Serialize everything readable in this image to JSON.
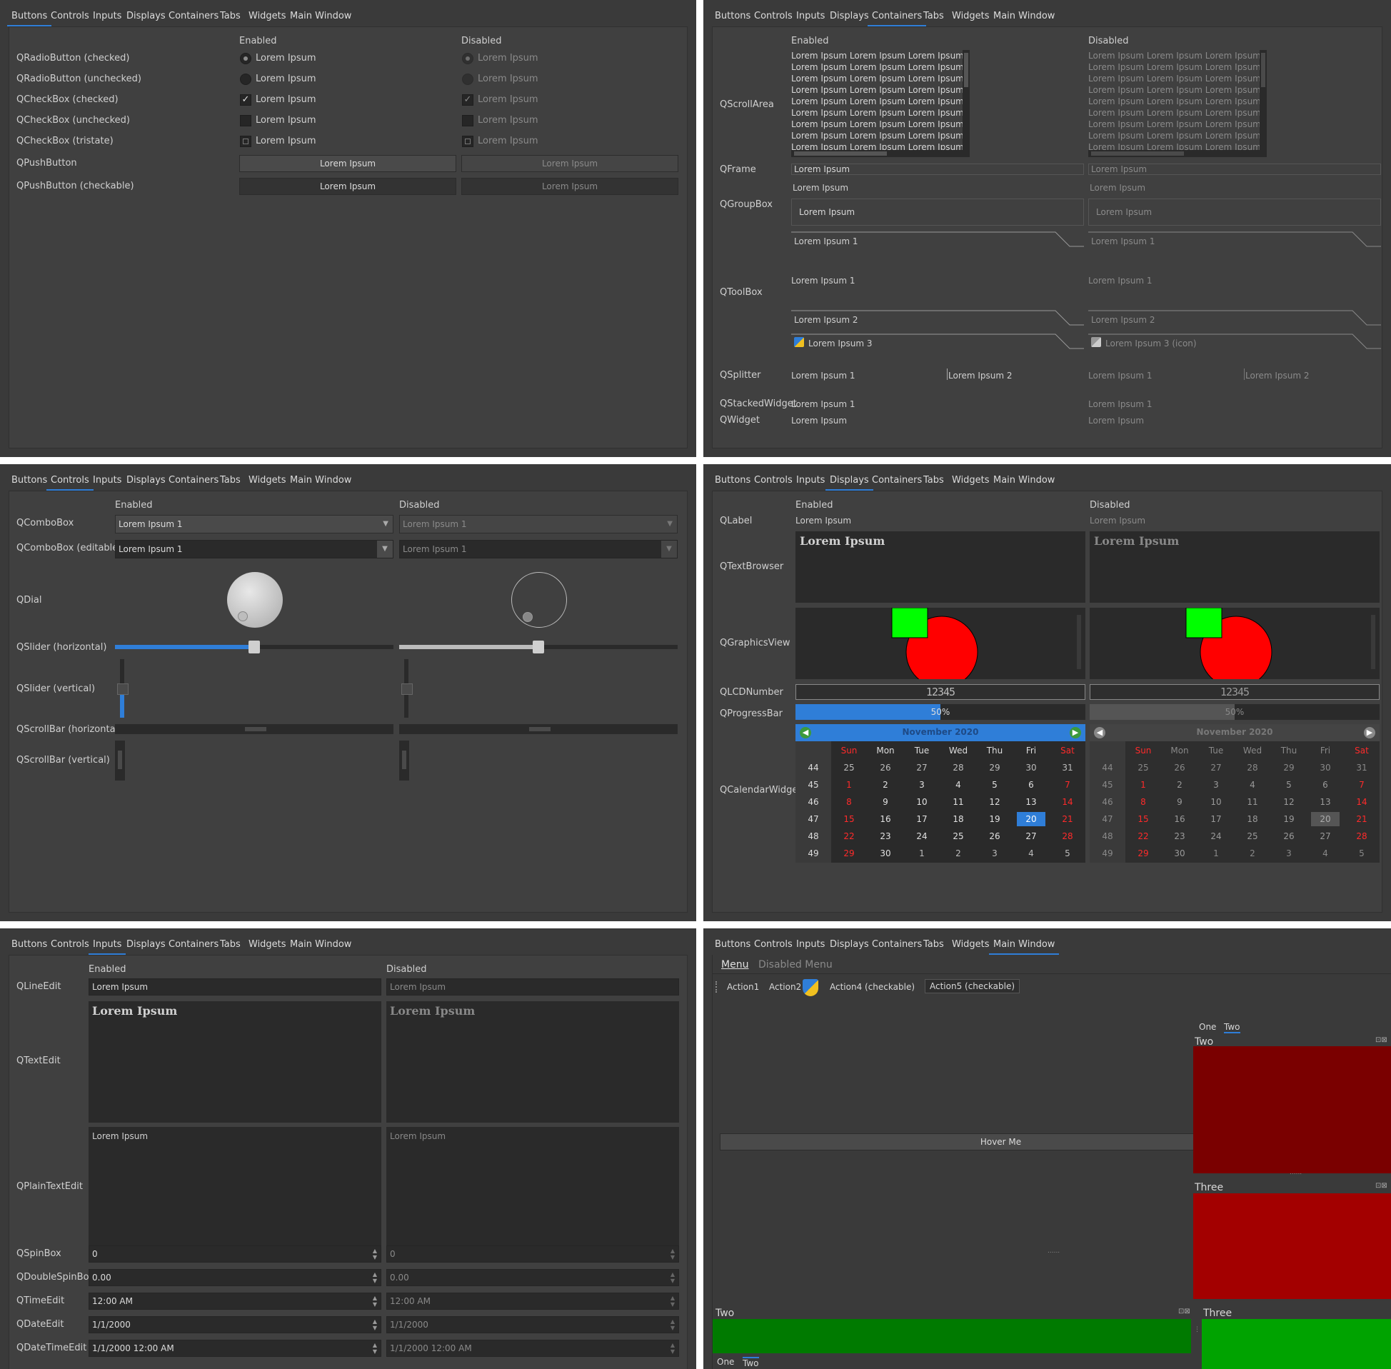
{
  "tabs": [
    "Buttons",
    "Controls",
    "Inputs",
    "Displays",
    "Containers",
    "Tabs",
    "Widgets",
    "Main Window"
  ],
  "common": {
    "enabled": "Enabled",
    "disabled": "Disabled",
    "lorem": "Lorem Ipsum",
    "lorem1": "Lorem Ipsum 1",
    "lorem2": "Lorem Ipsum 2",
    "lorem3": "Lorem Ipsum 3",
    "lorem3icon": "Lorem Ipsum 3 (icon)",
    "scroll_line": "Lorem Ipsum Lorem Ipsum Lorem Ipsum"
  },
  "buttons_panel": {
    "active_tab": "Buttons",
    "rows": [
      "QRadioButton (checked)",
      "QRadioButton (unchecked)",
      "QCheckBox (checked)",
      "QCheckBox (unchecked)",
      "QCheckBox (tristate)",
      "QPushButton",
      "QPushButton (checkable)"
    ]
  },
  "containers_panel": {
    "active_tab": "Containers",
    "rows": {
      "scroll": "QScrollArea",
      "frame": "QFrame",
      "group": "QGroupBox",
      "toolbox": "QToolBox",
      "splitter": "QSplitter",
      "stacked": "QStackedWidget",
      "widget": "QWidget"
    }
  },
  "controls_panel": {
    "active_tab": "Controls",
    "rows": {
      "combo": "QComboBox",
      "combo_edit": "QComboBox (editable)",
      "dial": "QDial",
      "slider_h": "QSlider (horizontal)",
      "slider_v": "QSlider (vertical)",
      "scroll_h": "QScrollBar (horizontal)",
      "scroll_v": "QScrollBar (vertical)"
    },
    "slider_value": 0.5
  },
  "displays_panel": {
    "active_tab": "Displays",
    "rows": {
      "label": "QLabel",
      "textbrowser": "QTextBrowser",
      "graphics": "QGraphicsView",
      "lcd": "QLCDNumber",
      "progress": "QProgressBar",
      "calendar": "QCalendarWidget"
    },
    "lcd_value": "12345",
    "progress_value": 0.5,
    "progress_text": "50%",
    "calendar": {
      "month": "November",
      "year": "2020",
      "days": [
        "Sun",
        "Mon",
        "Tue",
        "Wed",
        "Thu",
        "Fri",
        "Sat"
      ],
      "weeks": [
        "44",
        "45",
        "46",
        "47",
        "48",
        "49"
      ],
      "dates": [
        [
          "25",
          "26",
          "27",
          "28",
          "29",
          "30",
          "31"
        ],
        [
          "1",
          "2",
          "3",
          "4",
          "5",
          "6",
          "7"
        ],
        [
          "8",
          "9",
          "10",
          "11",
          "12",
          "13",
          "14"
        ],
        [
          "15",
          "16",
          "17",
          "18",
          "19",
          "20",
          "21"
        ],
        [
          "22",
          "23",
          "24",
          "25",
          "26",
          "27",
          "28"
        ],
        [
          "29",
          "30",
          "1",
          "2",
          "3",
          "4",
          "5"
        ]
      ],
      "selected": "20",
      "weekend_color": "#ff2a2a",
      "header_color": "#2f7ed8"
    }
  },
  "inputs_panel": {
    "active_tab": "Inputs",
    "rows": {
      "lineedit": "QLineEdit",
      "textedit": "QTextEdit",
      "plaintext": "QPlainTextEdit",
      "spin": "QSpinBox",
      "dspin": "QDoubleSpinBox",
      "time": "QTimeEdit",
      "date": "QDateEdit",
      "datetime": "QDateTimeEdit"
    },
    "values": {
      "spin": "0",
      "dspin": "0.00",
      "time": "12:00 AM",
      "date": "1/1/2000",
      "datetime": "1/1/2000 12:00 AM"
    }
  },
  "mainwindow_panel": {
    "active_tab": "Main Window",
    "menus": [
      "Menu",
      "Disabled Menu"
    ],
    "toolbar": [
      "Action1",
      "Action2",
      "Action4 (checkable)",
      "Action5 (checkable)"
    ],
    "hover_button": "Hover Me",
    "dock_tabs_top": [
      "One",
      "Two"
    ],
    "dock_tabs_bottom": [
      "One",
      "Two"
    ],
    "docks": {
      "two_right": "Two",
      "three_right": "Three",
      "two_bottom": "Two",
      "three_bottom": "Three"
    },
    "dock_colors": {
      "two_right": "#7a0000",
      "three_right": "#a30000",
      "two_bottom": "#007a00",
      "three_bottom": "#00a300"
    }
  },
  "accent_color": "#2f7ed8"
}
